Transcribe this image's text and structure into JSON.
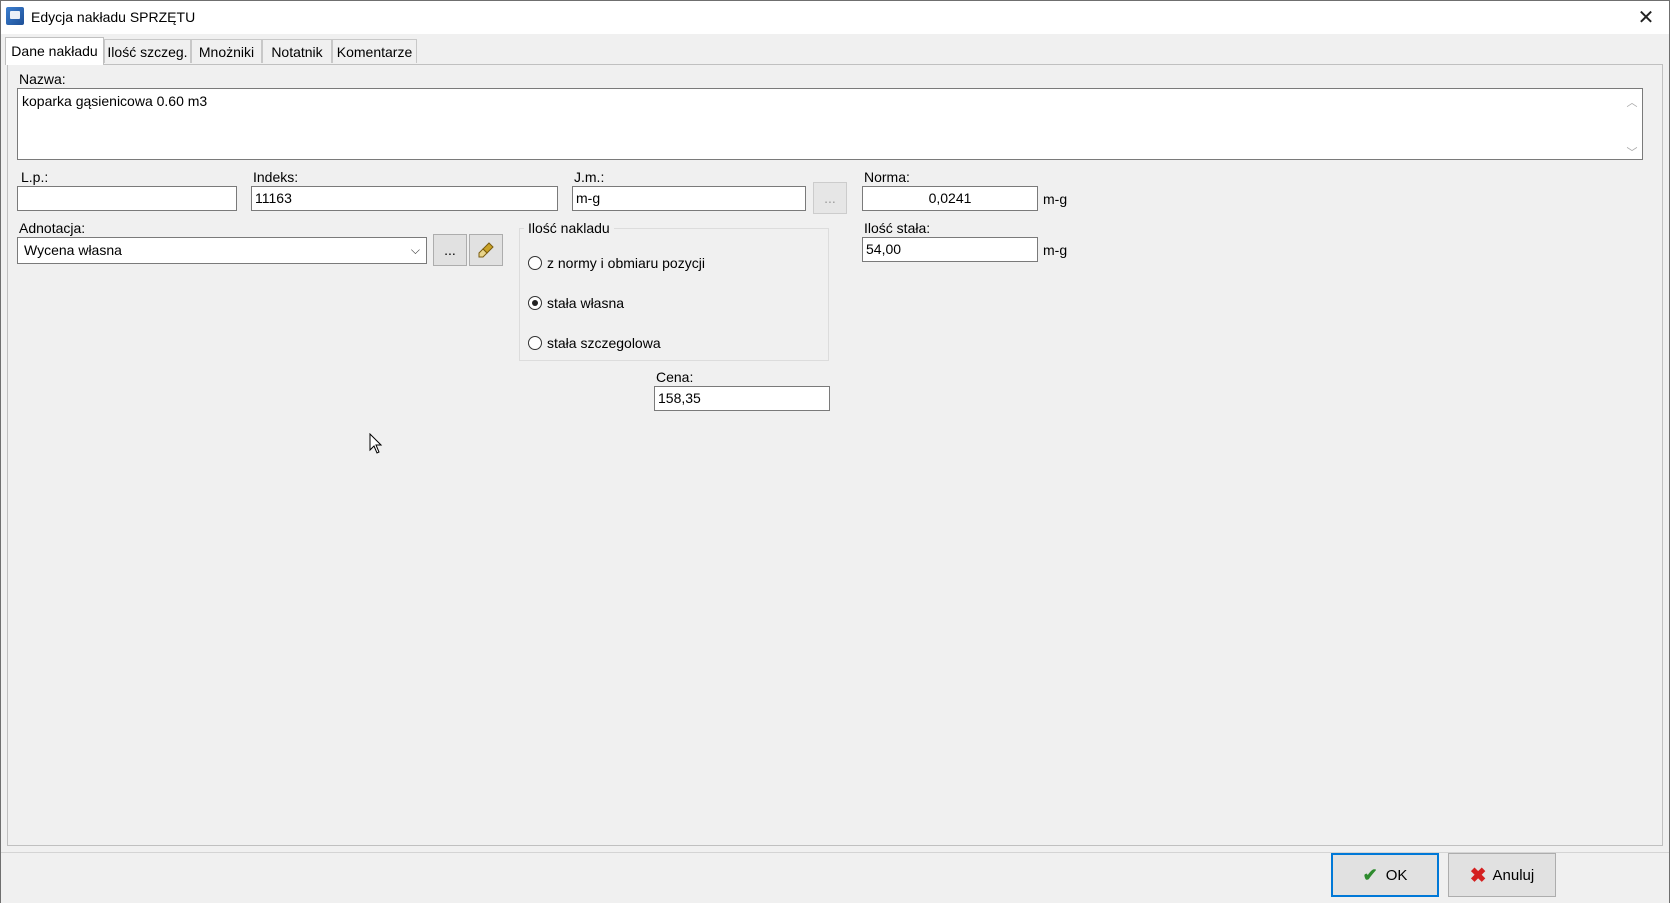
{
  "window": {
    "title": "Edycja nakładu SPRZĘTU"
  },
  "tabs": [
    {
      "label": "Dane nakładu",
      "active": true
    },
    {
      "label": "Ilość szczeg."
    },
    {
      "label": "Mnożniki"
    },
    {
      "label": "Notatnik"
    },
    {
      "label": "Komentarze"
    }
  ],
  "form": {
    "nazwa_label": "Nazwa:",
    "nazwa_value": "koparka gąsienicowa 0.60 m3",
    "lp_label": "L.p.:",
    "lp_value": "",
    "indeks_label": "Indeks:",
    "indeks_value": "11163",
    "jm_label": "J.m.:",
    "jm_value": "m-g",
    "jm_button": "...",
    "norma_label": "Norma:",
    "norma_value": "0,0241",
    "norma_unit": "m-g",
    "adnotacja_label": "Adnotacja:",
    "adnotacja_value": "Wycena własna",
    "adnotacja_button": "...",
    "ilosc_nakladu": {
      "title": "Ilość nakladu",
      "options": [
        {
          "label": "z normy i obmiaru pozycji",
          "checked": false
        },
        {
          "label": "stała własna",
          "checked": true
        },
        {
          "label": "stała szczegolowa",
          "checked": false
        }
      ]
    },
    "ilosc_stala_label": "Ilość stała:",
    "ilosc_stala_value": "54,00",
    "ilosc_stala_unit": "m-g",
    "cena_label": "Cena:",
    "cena_value": "158,35"
  },
  "buttons": {
    "ok": "OK",
    "cancel": "Anuluj"
  },
  "icons": {
    "app": "app-icon",
    "close": "close-icon",
    "clear": "eraser-brush-icon",
    "ok": "checkmark-icon",
    "cancel": "cross-icon",
    "dropdown": "chevron-down-icon"
  },
  "colors": {
    "ok_border": "#0078d7",
    "ok_check": "#2e8b2e",
    "cancel_cross": "#d42020"
  }
}
